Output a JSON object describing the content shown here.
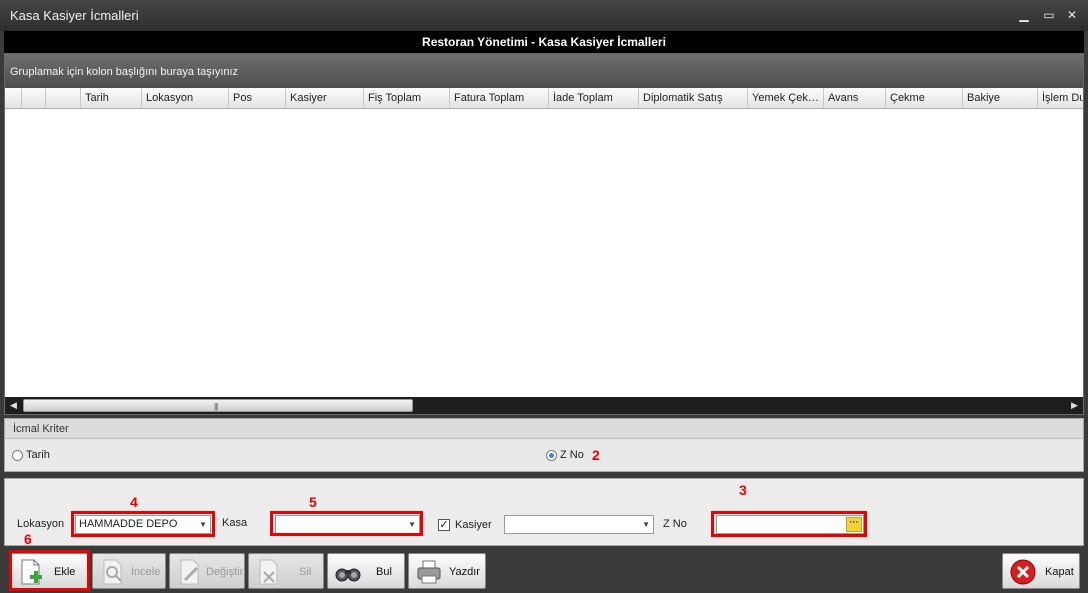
{
  "window": {
    "title": "Kasa Kasiyer İcmalleri",
    "minimize": "▁",
    "maximize": "▭",
    "close": "✕"
  },
  "header": {
    "title": "Restoran Yönetimi - Kasa Kasiyer İcmalleri"
  },
  "grid": {
    "group_hint": "Gruplamak için kolon başlığını buraya taşıyınız",
    "columns": [
      "",
      "",
      "",
      "Tarih",
      "Lokasyon",
      "Pos",
      "Kasiyer",
      "Fiş Toplam",
      "Fatura Toplam",
      "İade Toplam",
      "Diplomatik Satış",
      "Yemek Çek…",
      "Avans",
      "Çekme",
      "Bakiye",
      "İşlem Du"
    ]
  },
  "criteria": {
    "caption": "İcmal Kriter",
    "radio_tarih": "Tarih",
    "radio_zno": "Z No",
    "selected": "Z No"
  },
  "filters": {
    "lokasyon_label": "Lokasyon",
    "lokasyon_value": "HAMMADDE DEPO",
    "kasa_label": "Kasa",
    "kasa_value": "",
    "kasiyer_checked": true,
    "kasiyer_label": "Kasiyer",
    "kasiyer_value": "",
    "zno_label": "Z No",
    "zno_value": ""
  },
  "annotations": {
    "n2": "2",
    "n3": "3",
    "n4": "4",
    "n5": "5",
    "n6": "6"
  },
  "toolbar": {
    "ekle": "Ekle",
    "incele": "İncele",
    "degistir": "Değiştir",
    "sil": "Sil",
    "bul": "Bul",
    "yazdir": "Yazdır",
    "kapat": "Kapat"
  },
  "colors": {
    "annotation_red": "#e00000",
    "accent_blue": "#3a89d8"
  }
}
